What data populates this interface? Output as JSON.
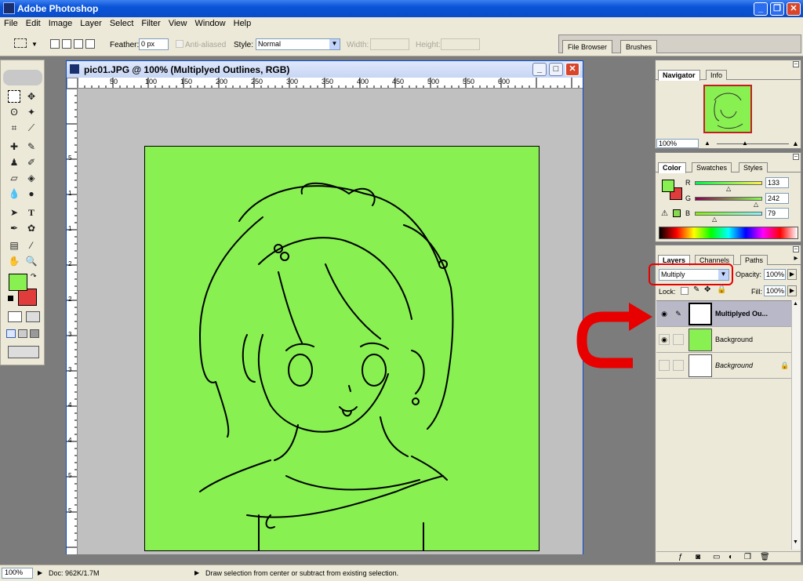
{
  "app": {
    "title": "Adobe Photoshop"
  },
  "menu": [
    "File",
    "Edit",
    "Image",
    "Layer",
    "Select",
    "Filter",
    "View",
    "Window",
    "Help"
  ],
  "options": {
    "feather_label": "Feather:",
    "feather_value": "0 px",
    "antialiased_label": "Anti-aliased",
    "style_label": "Style:",
    "style_value": "Normal",
    "width_label": "Width:",
    "height_label": "Height:"
  },
  "palette_well": {
    "tabs": [
      "File Browser",
      "Brushes"
    ]
  },
  "document": {
    "title": "pic01.JPG @ 100% (Multiplyed Outlines, RGB)",
    "ruler_h": [
      "50",
      "100",
      "150",
      "200",
      "250",
      "300",
      "350",
      "400",
      "450",
      "500",
      "550",
      "600"
    ],
    "ruler_v": [
      "5",
      "1",
      "1",
      "2",
      "2",
      "3",
      "3",
      "4",
      "4",
      "5",
      "5"
    ],
    "canvas_color": "#88f050"
  },
  "navigator": {
    "tabs": [
      "Navigator",
      "Info"
    ],
    "zoom": "100%"
  },
  "color_panel": {
    "tabs": [
      "Color",
      "Swatches",
      "Styles"
    ],
    "r_label": "R",
    "r_value": "133",
    "g_label": "G",
    "g_value": "242",
    "b_label": "B",
    "b_value": "79",
    "foreground": "#88f050",
    "background": "#e03c3c"
  },
  "layers_panel": {
    "tabs": [
      "Layers",
      "Channels",
      "Paths"
    ],
    "blend_mode": "Multiply",
    "opacity_label": "Opacity:",
    "opacity_value": "100%",
    "lock_label": "Lock:",
    "fill_label": "Fill:",
    "fill_value": "100%",
    "layers": [
      {
        "name": "Multiplyed Ou...",
        "selected": true
      },
      {
        "name": "Background",
        "selected": false
      },
      {
        "name": "Background",
        "selected": false,
        "locked": true
      }
    ]
  },
  "status": {
    "zoom": "100%",
    "doc": "Doc: 962K/1.7M",
    "hint": "Draw selection from center or subtract from existing selection."
  },
  "annotation": {
    "arrow_color": "#e80000"
  }
}
